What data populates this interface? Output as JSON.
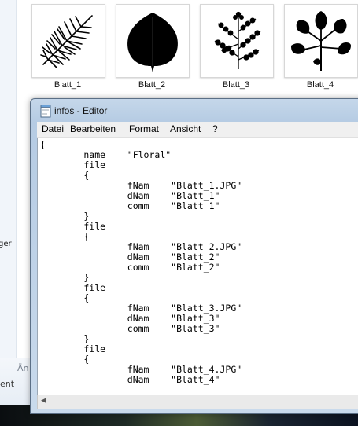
{
  "explorer": {
    "thumbnails": [
      {
        "label": "Blatt_1",
        "icon": "fern-frond-icon"
      },
      {
        "label": "Blatt_2",
        "icon": "birch-leaf-icon"
      },
      {
        "label": "Blatt_3",
        "icon": "fern-branch-icon"
      },
      {
        "label": "Blatt_4",
        "icon": "compound-leaf-icon"
      }
    ],
    "nav_fragment": "ger",
    "details_fragment_1": "Än",
    "details_fragment_2": "ent"
  },
  "notepad": {
    "title": "infos - Editor",
    "menu": [
      "Datei",
      "Bearbeiten",
      "Format",
      "Ansicht",
      "?"
    ],
    "content": "{\n        name    \"Floral\"\n        file\n        {\n                fNam    \"Blatt_1.JPG\"\n                dNam    \"Blatt_1\"\n                comm    \"Blatt_1\"\n        }\n        file\n        {\n                fNam    \"Blatt_2.JPG\"\n                dNam    \"Blatt_2\"\n                comm    \"Blatt_2\"\n        }\n        file\n        {\n                fNam    \"Blatt_3.JPG\"\n                dNam    \"Blatt_3\"\n                comm    \"Blatt_3\"\n        }\n        file\n        {\n                fNam    \"Blatt_4.JPG\"\n                dNam    \"Blatt_4\""
  }
}
